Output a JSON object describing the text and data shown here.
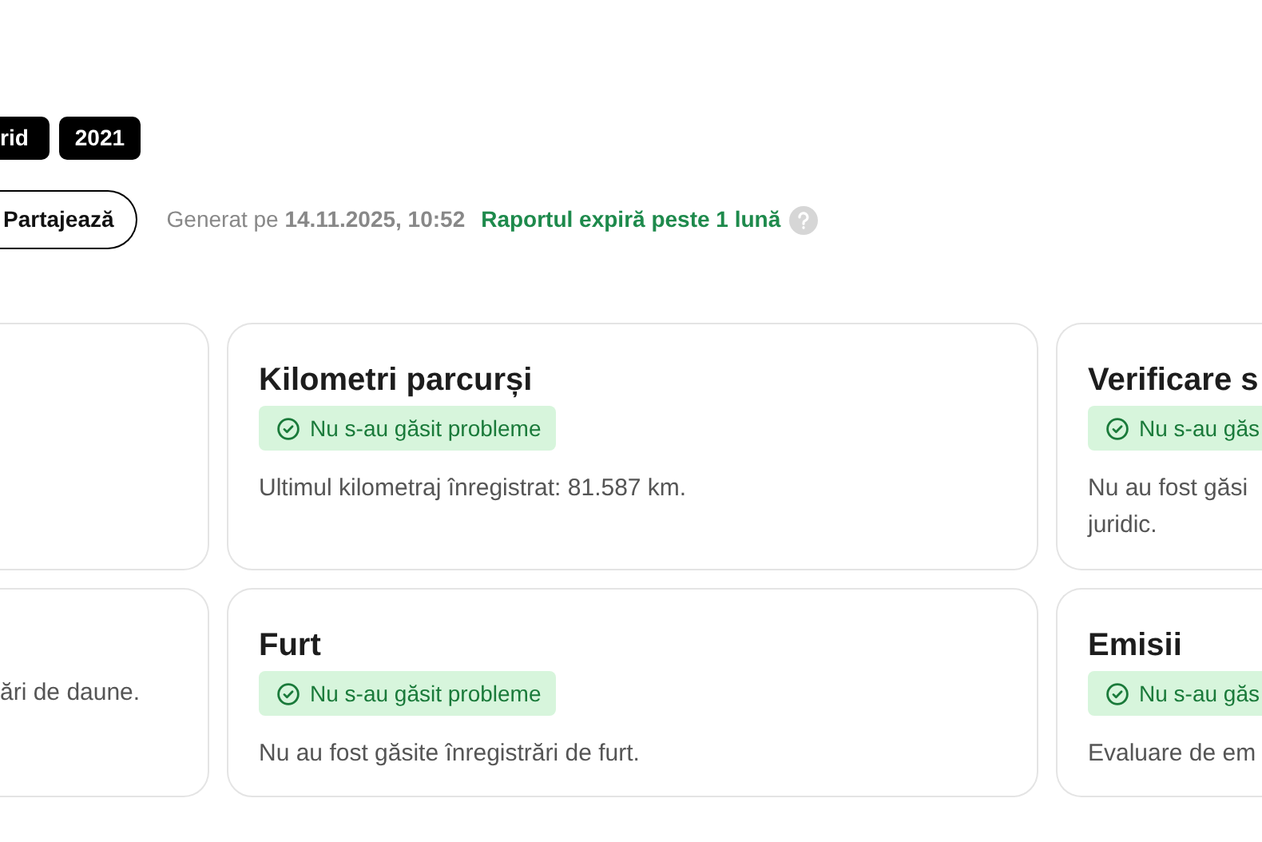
{
  "tags": [
    {
      "label": "rid"
    },
    {
      "label": "2021"
    }
  ],
  "share_button": {
    "label": "Partajează"
  },
  "generated": "Generat pe **14.11.2025, 10:52**",
  "expiry": {
    "label": "Raportul expiră peste 1 lună"
  },
  "card_rows": [
    {
      "cards": [
        {
          "kind": "left"
        },
        {
          "kind": "middle",
          "title": "Kilometri parcurși",
          "status": {
            "kind": "ok",
            "label": "Nu s-au găsit probleme"
          },
          "text": [
            "Ultimul kilometraj înregistrat: 81.587 km."
          ]
        },
        {
          "kind": "right",
          "title": "Verificare s",
          "status": {
            "kind": "ok",
            "label": "Nu s-au găs"
          },
          "text": [
            "Nu au fost găsi",
            "juridic."
          ]
        }
      ]
    },
    {
      "cards": [
        {
          "kind": "left",
          "text": [
            "ări de daune."
          ]
        },
        {
          "kind": "middle",
          "title": "Furt",
          "status": {
            "kind": "ok",
            "label": "Nu s-au găsit probleme"
          },
          "text": [
            "Nu au fost găsite înregistrări de furt."
          ]
        },
        {
          "kind": "right",
          "title": "Emisii",
          "status": {
            "kind": "ok",
            "label": "Nu s-au găs"
          },
          "text": [
            "Evaluare de em"
          ]
        }
      ]
    }
  ]
}
